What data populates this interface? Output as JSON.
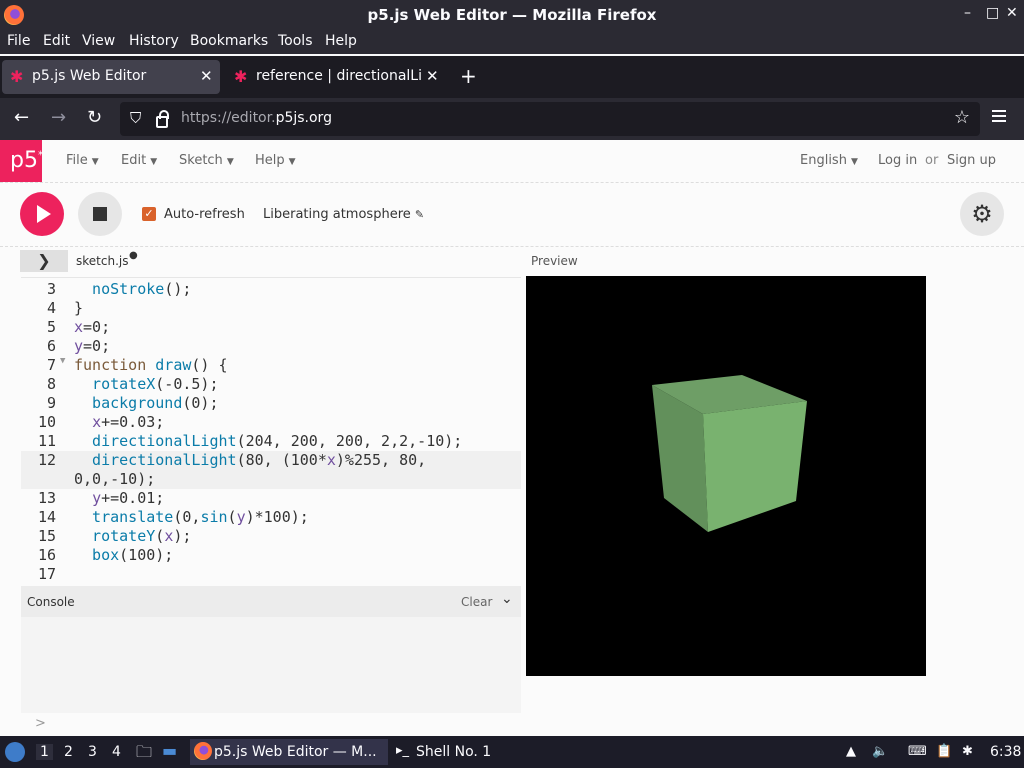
{
  "window": {
    "title": "p5.js Web Editor — Mozilla Firefox",
    "controls": [
      "–",
      "□",
      "✕"
    ]
  },
  "menubar": {
    "items": [
      "File",
      "Edit",
      "View",
      "History",
      "Bookmarks",
      "Tools",
      "Help"
    ]
  },
  "tabs": [
    {
      "label": "p5.js Web Editor",
      "active": true
    },
    {
      "label": "reference | directionalLig",
      "active": false
    }
  ],
  "navbar": {
    "url_prefix": "https://editor.",
    "url_domain": "p5js.org"
  },
  "p5app": {
    "logo": "p5",
    "logo_sup": "*",
    "menu": [
      "File",
      "Edit",
      "Sketch",
      "Help"
    ],
    "language": "English",
    "login": "Log in",
    "or": "or",
    "signup": "Sign up",
    "auto_refresh_label": "Auto-refresh",
    "auto_refresh_checked": true,
    "sketch_name": "Liberating atmosphere",
    "file_tab": "sketch.js",
    "unsaved_dot": "●",
    "preview_label": "Preview",
    "console_label": "Console",
    "clear_label": "Clear",
    "console_prompt": ">"
  },
  "code_lines": [
    {
      "num": "3",
      "text": "  noStroke();"
    },
    {
      "num": "4",
      "text": "}"
    },
    {
      "num": "5",
      "text": "x=0;"
    },
    {
      "num": "6",
      "text": "y=0;"
    },
    {
      "num": "7",
      "text": "function draw() {"
    },
    {
      "num": "8",
      "text": "  rotateX(-0.5);"
    },
    {
      "num": "9",
      "text": "  background(0);"
    },
    {
      "num": "10",
      "text": "  x+=0.03;"
    },
    {
      "num": "11",
      "text": "  directionalLight(204, 200, 200, 2,2,-10);"
    },
    {
      "num": "12",
      "text": "  directionalLight(80, (100*x)%255, 80,"
    },
    {
      "num": "",
      "text": "0,0,-10);"
    },
    {
      "num": "13",
      "text": "  y+=0.01;"
    },
    {
      "num": "14",
      "text": "  translate(0,sin(y)*100);"
    },
    {
      "num": "15",
      "text": "  rotateY(x);"
    },
    {
      "num": "16",
      "text": "  box(100);"
    },
    {
      "num": "17",
      "text": ""
    }
  ],
  "taskbar": {
    "workspaces": [
      "1",
      "2",
      "3",
      "4"
    ],
    "apps": [
      {
        "label": "p5.js Web Editor — M...",
        "active": true
      },
      {
        "label": "Shell No. 1",
        "active": false
      }
    ],
    "clock": "6:38"
  },
  "colors": {
    "p5_pink": "#ed225d",
    "cube_front": "#79b26f",
    "cube_top": "#6e9e66",
    "cube_side": "#5f8d58"
  }
}
